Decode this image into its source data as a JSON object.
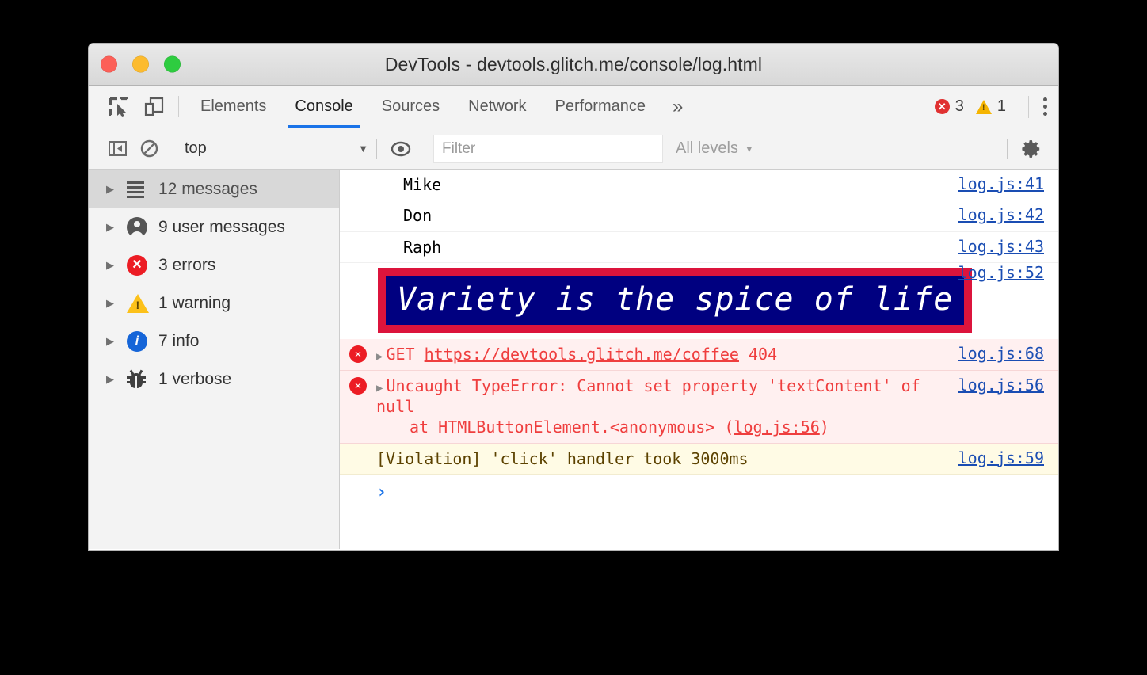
{
  "window": {
    "title": "DevTools - devtools.glitch.me/console/log.html",
    "traffic_lights": [
      "close-button",
      "minimize-button",
      "zoom-button"
    ]
  },
  "tabbar": {
    "inspect_icon": "inspect-element-icon",
    "device_icon": "device-toolbar-icon",
    "tabs": [
      {
        "label": "Elements",
        "active": false
      },
      {
        "label": "Console",
        "active": true
      },
      {
        "label": "Sources",
        "active": false
      },
      {
        "label": "Network",
        "active": false
      },
      {
        "label": "Performance",
        "active": false
      }
    ],
    "more_tabs_label": "»",
    "error_count": "3",
    "warning_count": "1",
    "error_badge_glyph": "✕",
    "kebab_label": "customize-and-control-devtools"
  },
  "console_toolbar": {
    "sidebar_toggle_icon": "show-console-sidebar-icon",
    "clear_icon": "clear-console-icon",
    "context_value": "top",
    "context_caret": "▼",
    "eye_icon": "create-live-expression-icon",
    "filter_placeholder": "Filter",
    "filter_value": "",
    "levels_label": "All levels",
    "levels_caret": "▼",
    "settings_icon": "console-settings-gear-icon"
  },
  "sidebar": {
    "items": [
      {
        "label": "12 messages",
        "icon": "list-icon",
        "selected": true
      },
      {
        "label": "9 user messages",
        "icon": "user-icon",
        "selected": false
      },
      {
        "label": "3 errors",
        "icon": "error-icon",
        "selected": false
      },
      {
        "label": "1 warning",
        "icon": "warning-icon",
        "selected": false
      },
      {
        "label": "7 info",
        "icon": "info-icon",
        "selected": false
      },
      {
        "label": "1 verbose",
        "icon": "bug-icon",
        "selected": false
      }
    ],
    "arrow_glyph": "▶"
  },
  "messages": [
    {
      "text": "Mike",
      "source": "log.js:41"
    },
    {
      "text": "Don",
      "source": "log.js:42"
    },
    {
      "text": "Raph",
      "source": "log.js:43"
    },
    {
      "banner_text": "Variety is the spice of life",
      "source": "log.js:52"
    },
    {
      "method": "GET",
      "url": "https://devtools.glitch.me/coffee",
      "status": "404",
      "source": "log.js:68"
    },
    {
      "text": "Uncaught TypeError: Cannot set property 'textContent' of null",
      "stack_prefix": "at HTMLButtonElement.<anonymous> (",
      "stack_link": "log.js:56",
      "stack_suffix": ")",
      "source": "log.js:56"
    },
    {
      "text": "[Violation] 'click' handler took 3000ms",
      "source": "log.js:59"
    }
  ],
  "prompt": {
    "caret": "›",
    "value": ""
  },
  "colors": {
    "accent_blue": "#1a73e8",
    "error_red": "#ec1c24",
    "warning_yellow": "#fcc11a",
    "info_blue": "#1565d8",
    "banner_border": "#dc143c",
    "banner_background": "#000080",
    "banner_text": "#ffffff"
  }
}
